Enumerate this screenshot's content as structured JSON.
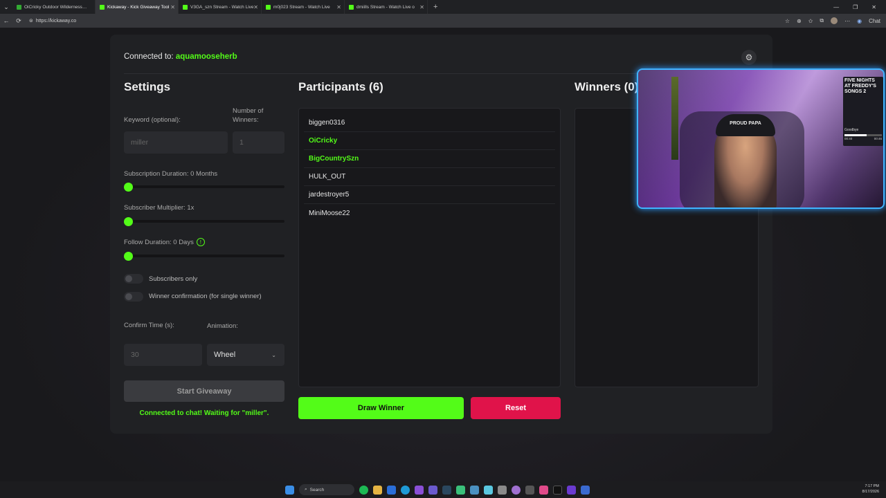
{
  "browser": {
    "tabs": [
      {
        "title": "OiCricky Outdoor Wilderness Gam",
        "active": false
      },
      {
        "title": "Kickaway - Kick Giveaway Tool",
        "active": true
      },
      {
        "title": "V3GA_szn Stream - Watch Live",
        "active": false
      },
      {
        "title": "m0j023 Stream - Watch Live",
        "active": false
      },
      {
        "title": "dmiills Stream - Watch Live o",
        "active": false
      }
    ],
    "url": "https://kickaway.co",
    "chat_label": "Chat"
  },
  "header": {
    "connected_label": "Connected to:",
    "channel": "aquamooseherb"
  },
  "settings": {
    "title": "Settings",
    "keyword_label": "Keyword (optional):",
    "keyword_value": "miller",
    "winners_label": "Number of Winners:",
    "winners_value": "1",
    "sub_duration_label": "Subscription Duration: 0 Months",
    "sub_duration_value": 0,
    "sub_multiplier_label": "Subscriber Multiplier: 1x",
    "sub_multiplier_value": 0,
    "follow_duration_label": "Follow Duration:  0  Days",
    "follow_duration_value": 0,
    "subscribers_only_label": "Subscribers only",
    "winner_confirmation_label": "Winner confirmation (for single winner)",
    "confirm_time_label": "Confirm Time (s):",
    "confirm_time_value": "30",
    "animation_label": "Animation:",
    "animation_value": "Wheel",
    "start_button": "Start Giveaway",
    "status": "Connected to chat! Waiting for \"miller\"."
  },
  "participants": {
    "title": "Participants (6)",
    "items": [
      {
        "name": "biggen0316",
        "highlight": false
      },
      {
        "name": "OiCricky",
        "highlight": true
      },
      {
        "name": "BigCountrySzn",
        "highlight": true
      },
      {
        "name": "HULK_OUT",
        "highlight": false
      },
      {
        "name": "jardestroyer5",
        "highlight": false
      },
      {
        "name": "MiniMoose22",
        "highlight": false
      }
    ],
    "draw_button": "Draw Winner",
    "reset_button": "Reset"
  },
  "winners": {
    "title": "Winners (0)"
  },
  "overlay": {
    "cap_text": "PROUD PAPA",
    "panel_title": "FIVE NIGHTS AT FREDDY'S SONGS 2",
    "song_title": "Goodbye",
    "time_start": "00:40",
    "time_end": "00:46",
    "progress": 0.6
  },
  "taskbar": {
    "search_label": "Search",
    "time": "7:17 PM",
    "date": "8/17/2026"
  },
  "colors": {
    "accent": "#53fc18",
    "danger": "#e0134a",
    "card": "#202124"
  }
}
